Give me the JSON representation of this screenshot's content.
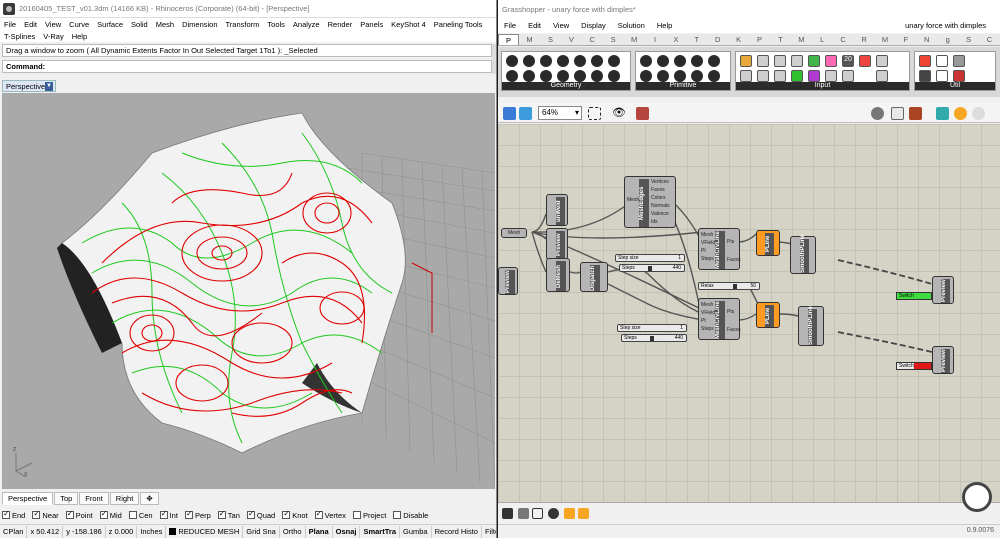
{
  "rhino": {
    "title": "20160405_TEST_v01.3dm (14166 KB) - Rhinoceros (Corporate) (64-bit) - [Perspective]",
    "menu1": [
      "File",
      "Edit",
      "View",
      "Curve",
      "Surface",
      "Solid",
      "Mesh",
      "Dimension",
      "Transform",
      "Tools",
      "Analyze",
      "Render",
      "Panels",
      "KeyShot 4",
      "Paneling Tools"
    ],
    "menu2": [
      "T-Splines",
      "V-Ray",
      "Help"
    ],
    "command_history": "Drag a window to zoom ( All  Dynamic  Extents  Factor  In  Out  Selected  Target  1To1 ): _Selected",
    "command_prompt": "Command:",
    "viewport_label": "Perspective",
    "viewport_tabs": [
      "Perspective",
      "Top",
      "Front",
      "Right"
    ],
    "osnaps": [
      {
        "label": "End",
        "on": true
      },
      {
        "label": "Near",
        "on": true
      },
      {
        "label": "Point",
        "on": true
      },
      {
        "label": "Mid",
        "on": true
      },
      {
        "label": "Cen",
        "on": false
      },
      {
        "label": "Int",
        "on": true
      },
      {
        "label": "Perp",
        "on": true
      },
      {
        "label": "Tan",
        "on": true
      },
      {
        "label": "Quad",
        "on": true
      },
      {
        "label": "Knot",
        "on": true
      },
      {
        "label": "Vertex",
        "on": true
      },
      {
        "label": "Project",
        "on": false
      },
      {
        "label": "Disable",
        "on": false
      }
    ],
    "status": {
      "cplane": "CPlan",
      "x": "x 50.412",
      "y": "y -158.186",
      "z": "z 0.000",
      "units": "Inches",
      "layer": "REDUCED MESH",
      "items": [
        "Grid Sna",
        "Ortho",
        "Plana",
        "Osnaj",
        "SmartTra",
        "Gumba",
        "Record Histo",
        "Filte"
      ],
      "bold_items": [
        "Plana",
        "Osnaj",
        "SmartTra"
      ]
    }
  },
  "grasshopper": {
    "title": "Grasshopper - unary force with dimples*",
    "menu": [
      "File",
      "Edit",
      "View",
      "Display",
      "Solution",
      "Help"
    ],
    "document_name": "unary force with dimples",
    "tabs": [
      "P",
      "M",
      "S",
      "V",
      "C",
      "S",
      "M",
      "I",
      "X",
      "T",
      "D",
      "K",
      "P",
      "T",
      "M",
      "L",
      "C",
      "R",
      "M",
      "F",
      "N",
      "g",
      "S",
      "C"
    ],
    "groups": [
      "Geometry",
      "Primitive",
      "Input",
      "Util"
    ],
    "zoom": "64%",
    "nodes": {
      "mesh": "Mesh",
      "preview1": "Preview",
      "preview2": "Preview",
      "mesh_edges": "MeshEdges",
      "unweld": "unWeld",
      "deMesh": "DeMesh",
      "dispatch": "Dispatch",
      "mesh_curve1": "MeshCrvLine",
      "mesh_curve2": "MeshCrvLine",
      "pline1": "PLine",
      "pline2": "PLine",
      "smooth1": "SmoothPLine",
      "smooth2": "SmoothPLine",
      "preview3": "Preview",
      "preview4": "Preview"
    },
    "mesh_edges_ports": [
      "Vertices",
      "Faces",
      "Colors",
      "Normals",
      "Valence",
      "Ids"
    ],
    "curve_ports_in": [
      "Mesh",
      "VField",
      "Pt",
      "Steps",
      "Step"
    ],
    "curve_ports_out": [
      "Pts",
      "Faces"
    ],
    "sliders": [
      {
        "label": "Step size",
        "value": "1"
      },
      {
        "label": "Steps",
        "value": "440"
      },
      {
        "label": "Step size",
        "value": "1"
      },
      {
        "label": "Steps",
        "value": "440"
      },
      {
        "label": "Relax",
        "value": "50"
      }
    ],
    "switches": [
      {
        "label": "Switch",
        "state": "green"
      },
      {
        "label": "Switch",
        "state": "red"
      }
    ],
    "version": "0.9.0076"
  },
  "colors": {
    "surface_curve_red": "#e00000",
    "surface_curve_green": "#1ec81e",
    "viewport_bg": "#a9a9a9",
    "canvas_bg": "#d5d2c6",
    "node_orange": "#ff9a23"
  }
}
